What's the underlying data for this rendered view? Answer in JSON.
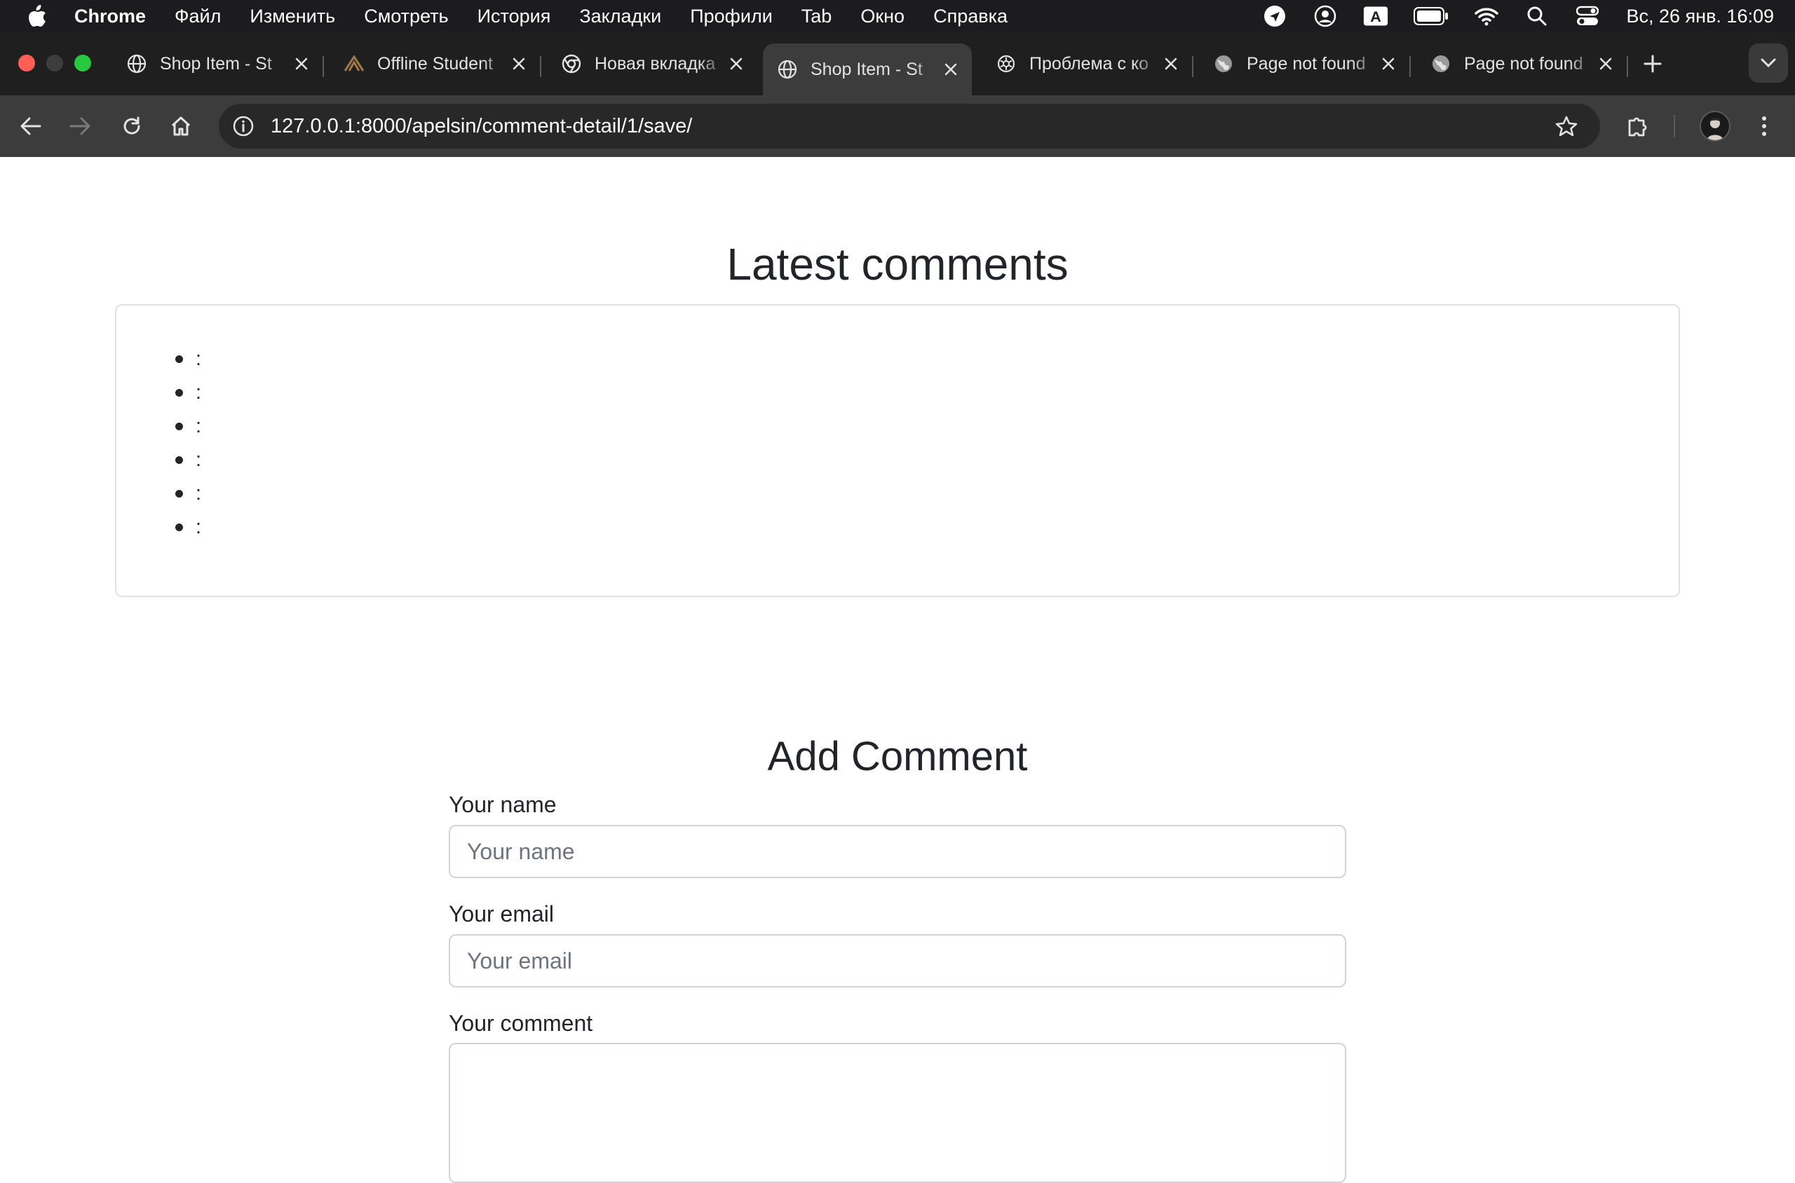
{
  "menubar": {
    "app_name": "Chrome",
    "items": [
      "Файл",
      "Изменить",
      "Смотреть",
      "История",
      "Закладки",
      "Профили",
      "Tab",
      "Окно",
      "Справка"
    ],
    "input_source": "A",
    "clock": "Вс, 26 янв.  16:09"
  },
  "tabs": [
    {
      "title": "Shop Item - St",
      "icon": "globe-icon",
      "active": false
    },
    {
      "title": "Offline Student",
      "icon": "brand-icon",
      "active": false
    },
    {
      "title": "Новая вкладка",
      "icon": "chrome-icon",
      "active": false
    },
    {
      "title": "Shop Item - St",
      "icon": "globe-icon",
      "active": true
    },
    {
      "title": "Проблема с ко",
      "icon": "openai-icon",
      "active": false
    },
    {
      "title": "Page not found",
      "icon": "globe-icon",
      "active": false
    },
    {
      "title": "Page not found",
      "icon": "globe-icon",
      "active": false
    }
  ],
  "address_bar": {
    "url": "127.0.0.1:8000/apelsin/comment-detail/1/save/"
  },
  "page": {
    "latest_title": "Latest comments",
    "comments": [
      ":",
      ":",
      ":",
      ":",
      ":",
      ":"
    ],
    "add_title": "Add Comment",
    "form": {
      "name_label": "Your name",
      "name_placeholder": "Your name",
      "email_label": "Your email",
      "email_placeholder": "Your email",
      "comment_label": "Your comment"
    }
  }
}
